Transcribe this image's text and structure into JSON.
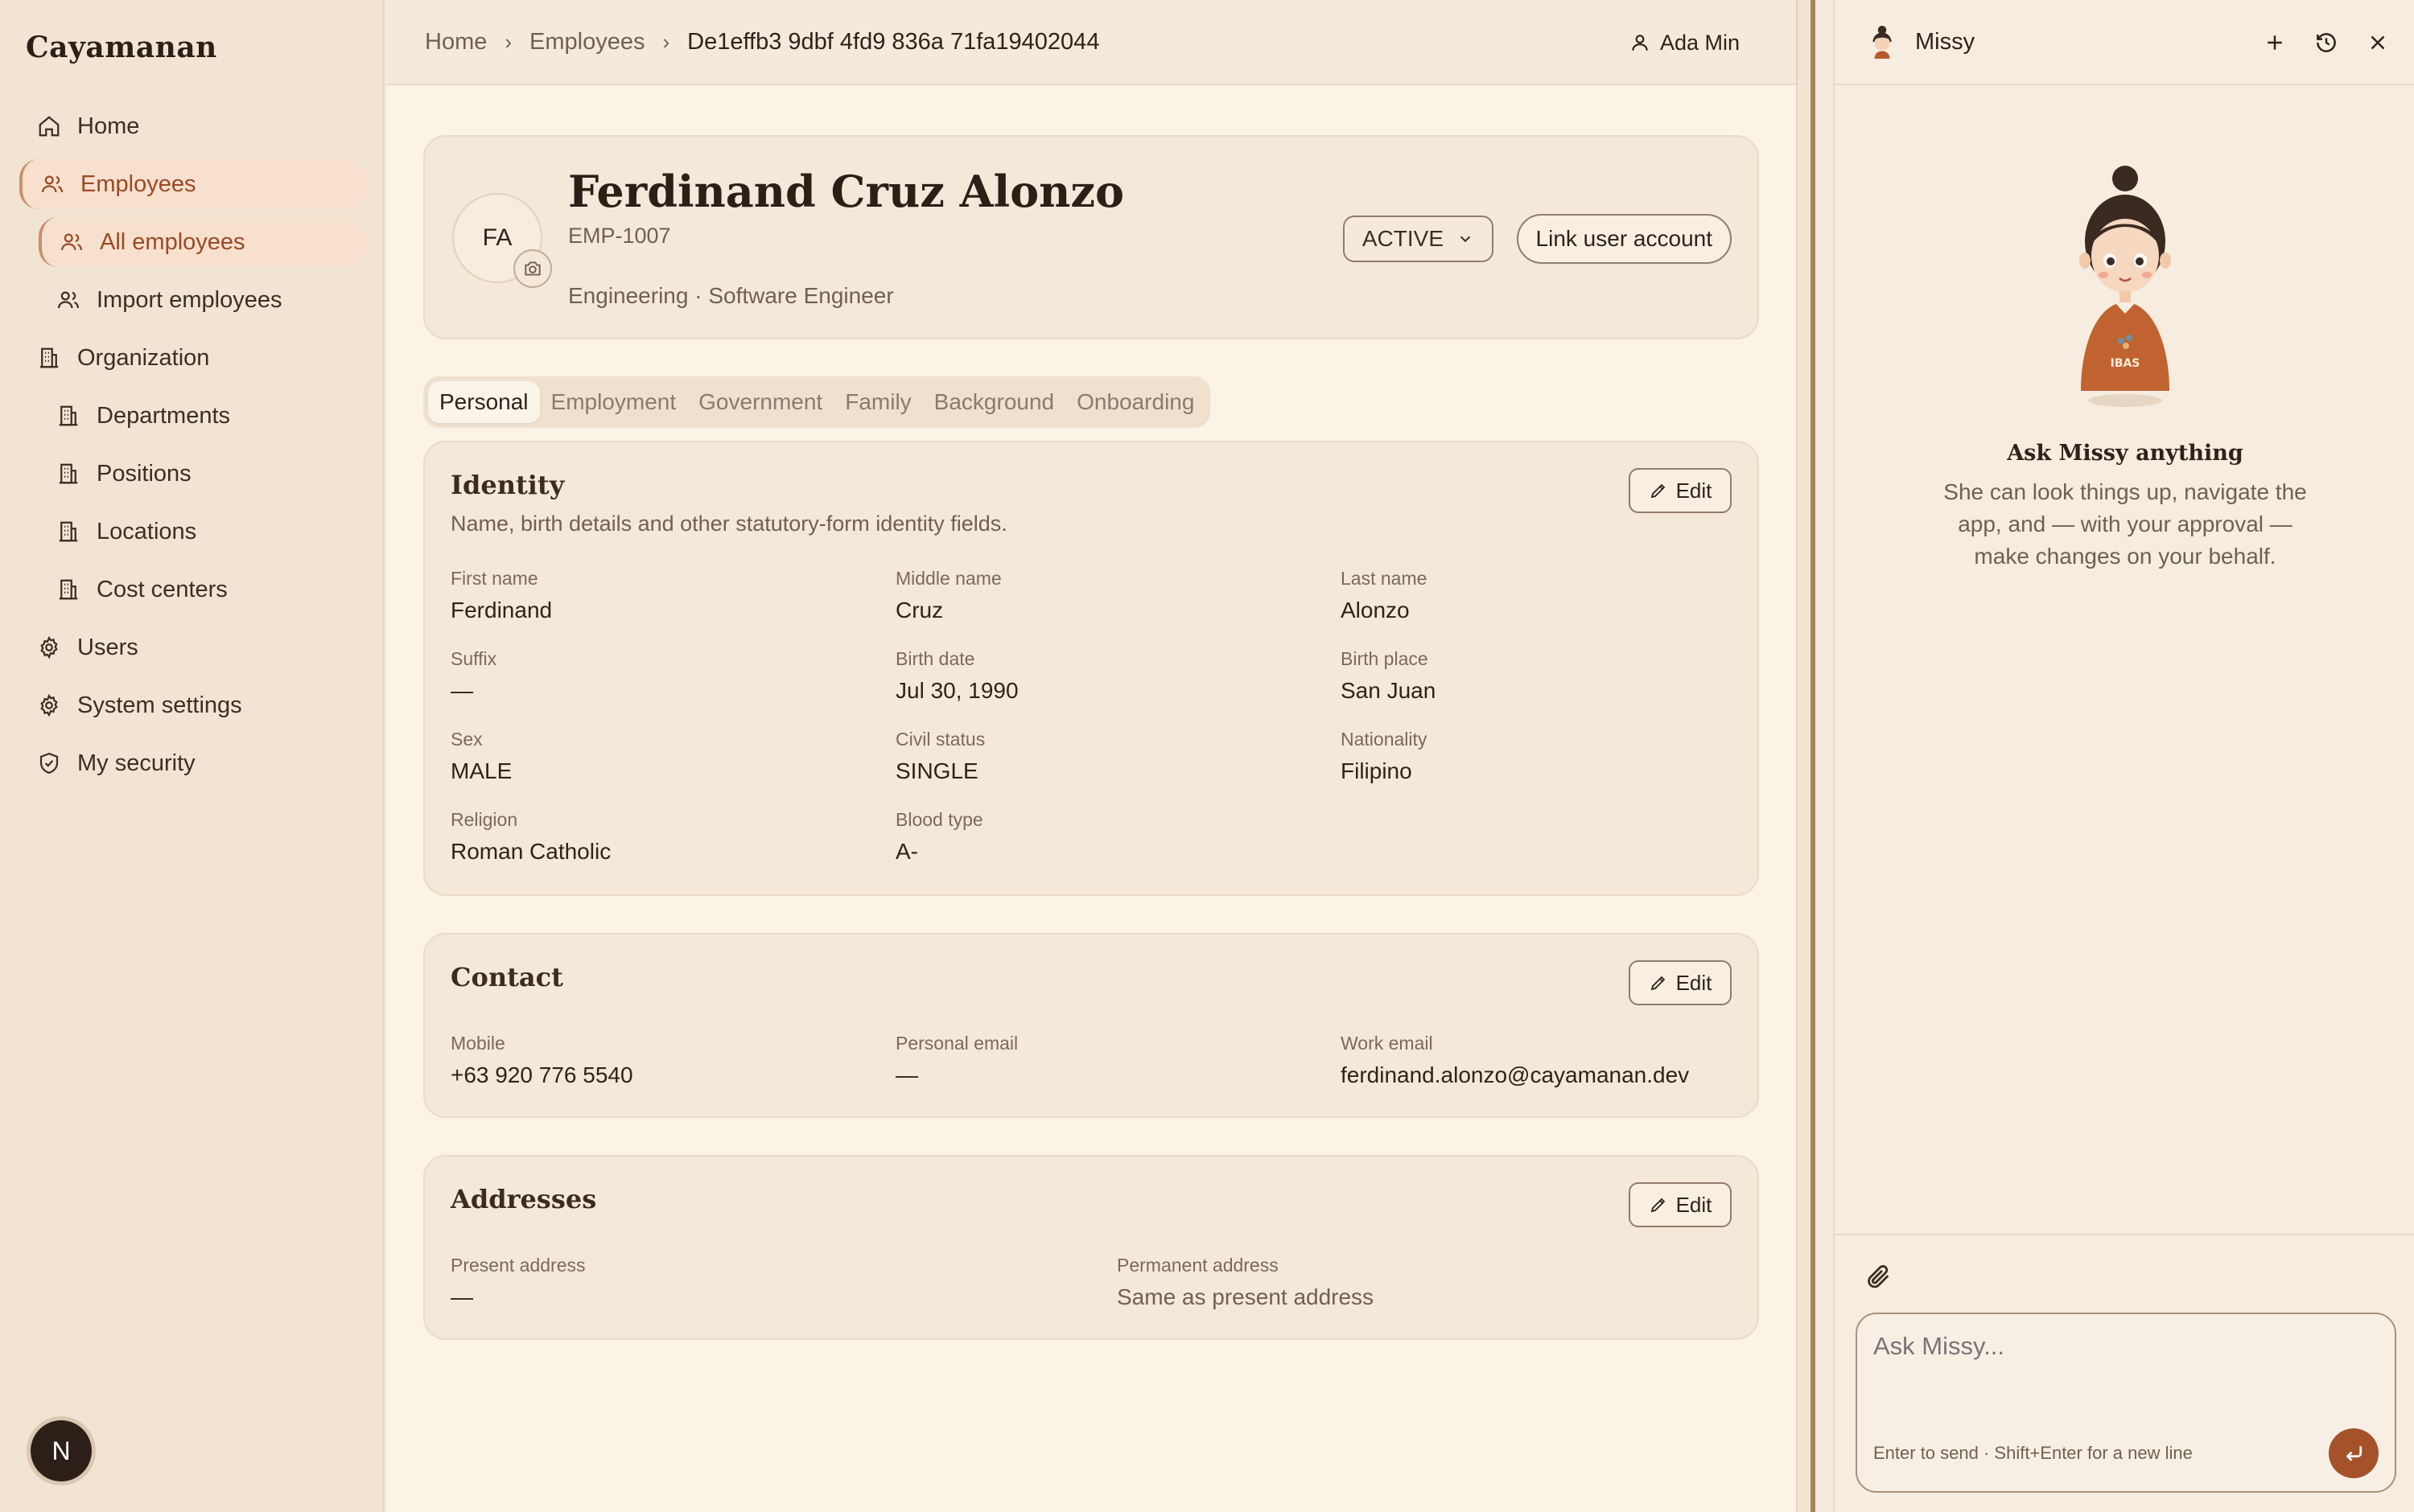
{
  "sidebar": {
    "brand": "Cayamanan",
    "items": [
      {
        "label": "Home",
        "icon": "home-icon"
      },
      {
        "label": "Employees",
        "icon": "users-icon"
      },
      {
        "label": "All employees",
        "icon": "users-icon"
      },
      {
        "label": "Import employees",
        "icon": "users-icon"
      },
      {
        "label": "Organization",
        "icon": "building-icon"
      },
      {
        "label": "Departments",
        "icon": "building-icon"
      },
      {
        "label": "Positions",
        "icon": "building-icon"
      },
      {
        "label": "Locations",
        "icon": "building-icon"
      },
      {
        "label": "Cost centers",
        "icon": "building-icon"
      },
      {
        "label": "Users",
        "icon": "gear-icon"
      },
      {
        "label": "System settings",
        "icon": "gear-icon"
      },
      {
        "label": "My security",
        "icon": "shield-icon"
      }
    ],
    "badge": "N"
  },
  "breadcrumb": {
    "home": "Home",
    "employees": "Employees",
    "current": "De1effb3 9dbf 4fd9 836a 71fa19402044"
  },
  "user": {
    "name": "Ada Min"
  },
  "employee": {
    "initials": "FA",
    "name": "Ferdinand Cruz Alonzo",
    "code": "EMP-1007",
    "role": "Engineering · Software Engineer",
    "status": "ACTIVE",
    "link_label": "Link user account"
  },
  "tabs": [
    "Personal",
    "Employment",
    "Government",
    "Family",
    "Background",
    "Onboarding"
  ],
  "identity": {
    "title": "Identity",
    "desc": "Name, birth details and other statutory-form identity fields.",
    "edit": "Edit",
    "fields": [
      {
        "label": "First name",
        "value": "Ferdinand"
      },
      {
        "label": "Middle name",
        "value": "Cruz"
      },
      {
        "label": "Last name",
        "value": "Alonzo"
      },
      {
        "label": "Suffix",
        "value": "—"
      },
      {
        "label": "Birth date",
        "value": "Jul 30, 1990"
      },
      {
        "label": "Birth place",
        "value": "San Juan"
      },
      {
        "label": "Sex",
        "value": "MALE"
      },
      {
        "label": "Civil status",
        "value": "SINGLE"
      },
      {
        "label": "Nationality",
        "value": "Filipino"
      },
      {
        "label": "Religion",
        "value": "Roman Catholic"
      },
      {
        "label": "Blood type",
        "value": "A-"
      }
    ]
  },
  "contact": {
    "title": "Contact",
    "edit": "Edit",
    "fields": [
      {
        "label": "Mobile",
        "value": "+63 920 776 5540"
      },
      {
        "label": "Personal email",
        "value": "—"
      },
      {
        "label": "Work email",
        "value": "ferdinand.alonzo@cayamanan.dev"
      }
    ]
  },
  "addresses": {
    "title": "Addresses",
    "edit": "Edit",
    "fields": [
      {
        "label": "Present address",
        "value": "—"
      },
      {
        "label": "Permanent address",
        "value": "Same as present address"
      }
    ]
  },
  "assistant": {
    "name": "Missy",
    "mascot_text": "IBAS",
    "heading": "Ask Missy anything",
    "subtext": "She can look things up, navigate the app, and — with your approval — make changes on your behalf.",
    "placeholder": "Ask Missy...",
    "hint": "Enter to send · Shift+Enter for a new line"
  }
}
